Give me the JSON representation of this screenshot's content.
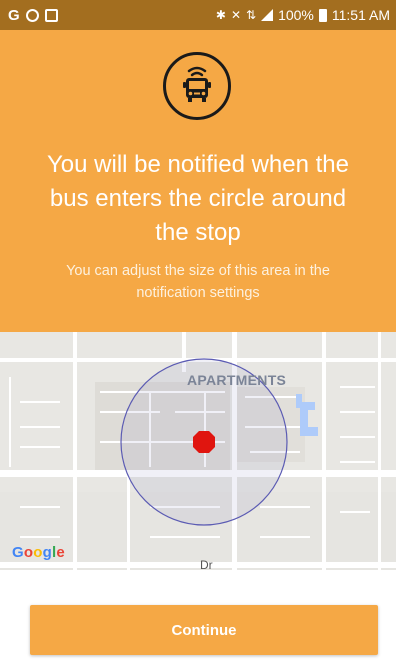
{
  "status_bar": {
    "left_icons": [
      "G",
      "messenger-icon",
      "gallery-icon"
    ],
    "right_icons": [
      "bluetooth-icon",
      "mute-icon",
      "4g-lte-icon",
      "signal-icon"
    ],
    "battery": "100%",
    "time": "11:51 AM"
  },
  "header": {
    "icon": "bus-icon",
    "title": "You will be notified when the bus enters the circle around the stop",
    "subtitle": "You can adjust the size of this area in the notification settings"
  },
  "map": {
    "label": "APARTMENTS",
    "street": "Dr",
    "logo": {
      "part1": "G",
      "part2": "o",
      "part3": "o",
      "part4": "g",
      "part5": "l",
      "part6": "e"
    },
    "stop_marker": "stop-marker-icon"
  },
  "footer": {
    "continue_label": "Continue"
  },
  "colors": {
    "accent": "#f5a845",
    "status_bar": "#a36e1f",
    "marker": "#e0150f",
    "circle_border": "#5b5bb3"
  }
}
